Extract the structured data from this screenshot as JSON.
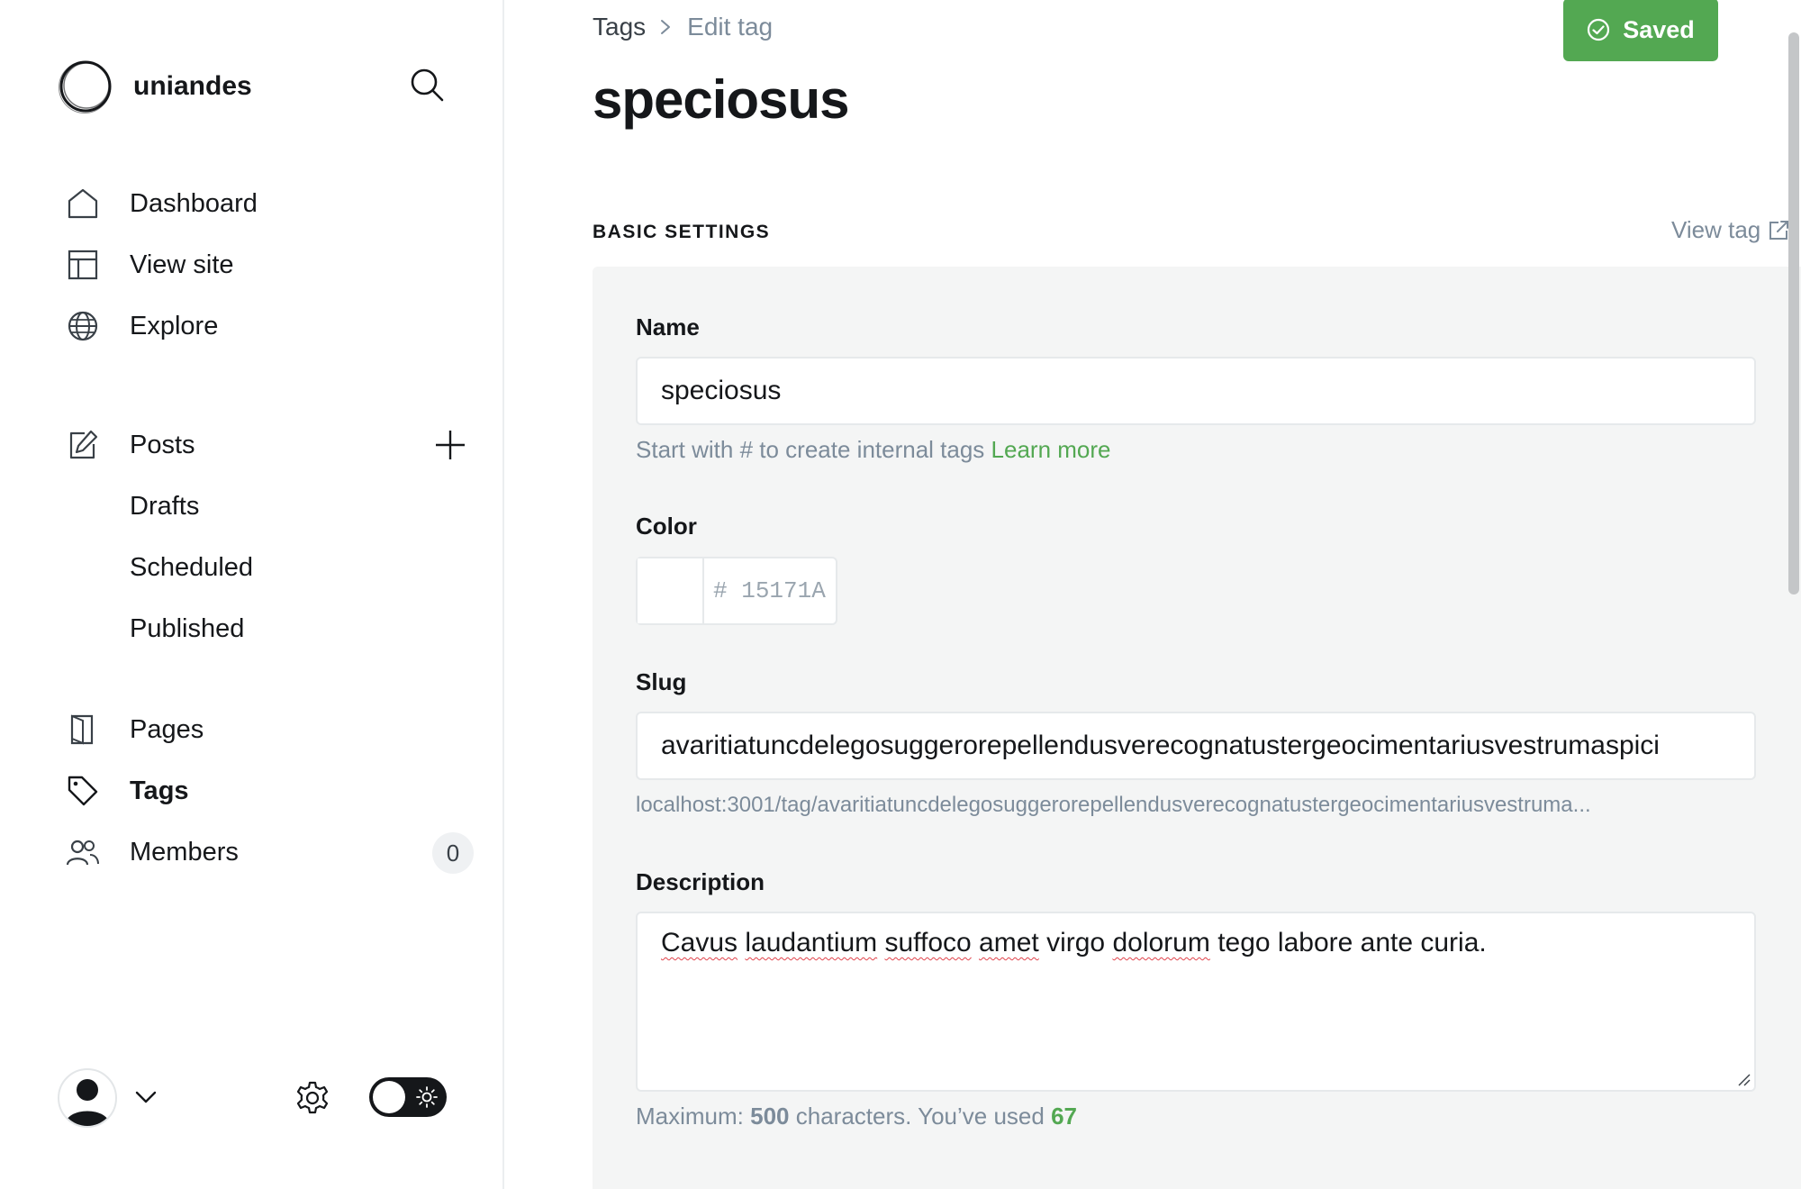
{
  "sidebar": {
    "brand_name": "uniandes",
    "search_icon": "search-icon",
    "primary_nav": [
      {
        "label": "Dashboard",
        "icon": "home-icon"
      },
      {
        "label": "View site",
        "icon": "layout-icon"
      },
      {
        "label": "Explore",
        "icon": "globe-icon"
      }
    ],
    "posts": {
      "label": "Posts",
      "icon": "edit-icon",
      "add_icon": "plus-icon",
      "children": [
        "Drafts",
        "Scheduled",
        "Published"
      ]
    },
    "secondary_nav": [
      {
        "label": "Pages",
        "icon": "page-icon"
      },
      {
        "label": "Tags",
        "icon": "tag-icon",
        "active": true
      },
      {
        "label": "Members",
        "icon": "users-icon",
        "count": "0"
      }
    ],
    "footer": {
      "avatar_icon": "user-avatar-icon",
      "chevron_icon": "chevron-down-icon",
      "settings_icon": "gear-icon",
      "theme_toggle": "dark"
    }
  },
  "header": {
    "breadcrumb_root": "Tags",
    "breadcrumb_current": "Edit tag",
    "title": "speciosus",
    "saved_label": "Saved",
    "saved_color": "#53a852"
  },
  "basic_settings": {
    "section_title": "BASIC SETTINGS",
    "view_tag_label": "View tag",
    "name_label": "Name",
    "name_value": "speciosus",
    "name_hint": "Start with # to create internal tags",
    "name_hint_link": "Learn more",
    "color_label": "Color",
    "color_hash": "#",
    "color_value": "15171A",
    "slug_label": "Slug",
    "slug_value": "avaritiatuncdelegosuggerorepellendusverecognatustergeocimentariusvestrumaspici",
    "slug_url": "localhost:3001/tag/avaritiatuncdelegosuggerorepellendusverecognatustergeocimentariusvestruma...",
    "description_label": "Description",
    "description_words": [
      "Cavus",
      "laudantium",
      "suffoco",
      "amet",
      "virgo",
      "dolorum",
      "tego labore ante curia."
    ],
    "desc_hint_prefix": "Maximum:",
    "desc_hint_max": "500",
    "desc_hint_middle": "characters. You’ve used",
    "desc_hint_used": "67"
  }
}
